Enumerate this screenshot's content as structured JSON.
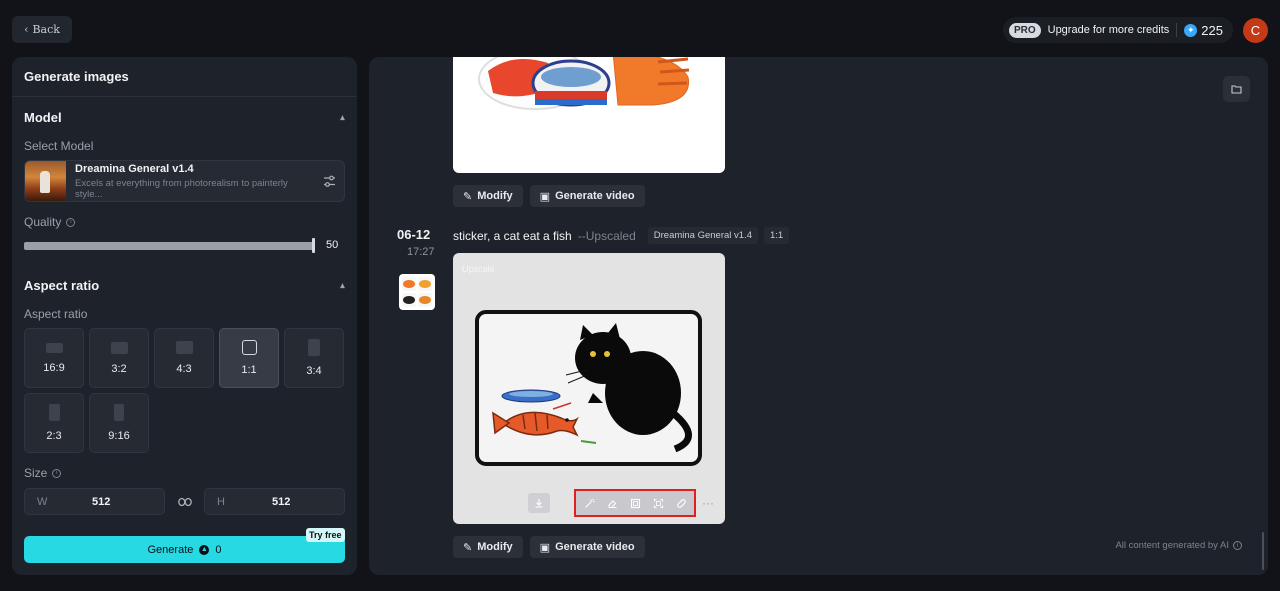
{
  "topbar": {
    "back_label": "Back",
    "pro_badge": "PRO",
    "upgrade_label": "Upgrade for more credits",
    "credits": "225",
    "avatar_letter": "C"
  },
  "left_panel": {
    "title": "Generate images",
    "model_section": {
      "heading": "Model",
      "select_label": "Select Model",
      "model_name": "Dreamina General v1.4",
      "model_desc": "Excels at everything from photorealism to painterly style..."
    },
    "quality": {
      "label": "Quality",
      "value": "50",
      "level": 1.0
    },
    "aspect_section": {
      "heading": "Aspect ratio",
      "sub_label": "Aspect ratio",
      "options": [
        "16:9",
        "3:2",
        "4:3",
        "1:1",
        "3:4",
        "2:3",
        "9:16"
      ],
      "selected": "1:1"
    },
    "size": {
      "label": "Size",
      "width_prefix": "W",
      "width_value": "512",
      "height_prefix": "H",
      "height_value": "512"
    },
    "generate": {
      "label": "Generate",
      "cost": "0",
      "badge": "Try free"
    }
  },
  "right_panel": {
    "actions": {
      "modify_label": "Modify",
      "video_label": "Generate video"
    },
    "entry": {
      "date": "06-12",
      "time": "17:27",
      "prompt": "sticker, a cat eat a fish",
      "tag": "--Upscaled",
      "model_chip": "Dreamina General v1.4",
      "ratio_chip": "1:1",
      "image_label": "Upscale"
    },
    "footer_note": "All content generated by AI"
  },
  "colors": {
    "accent": "#27d9e3",
    "avatar": "#c43a17",
    "highlight_box": "#e02020"
  }
}
